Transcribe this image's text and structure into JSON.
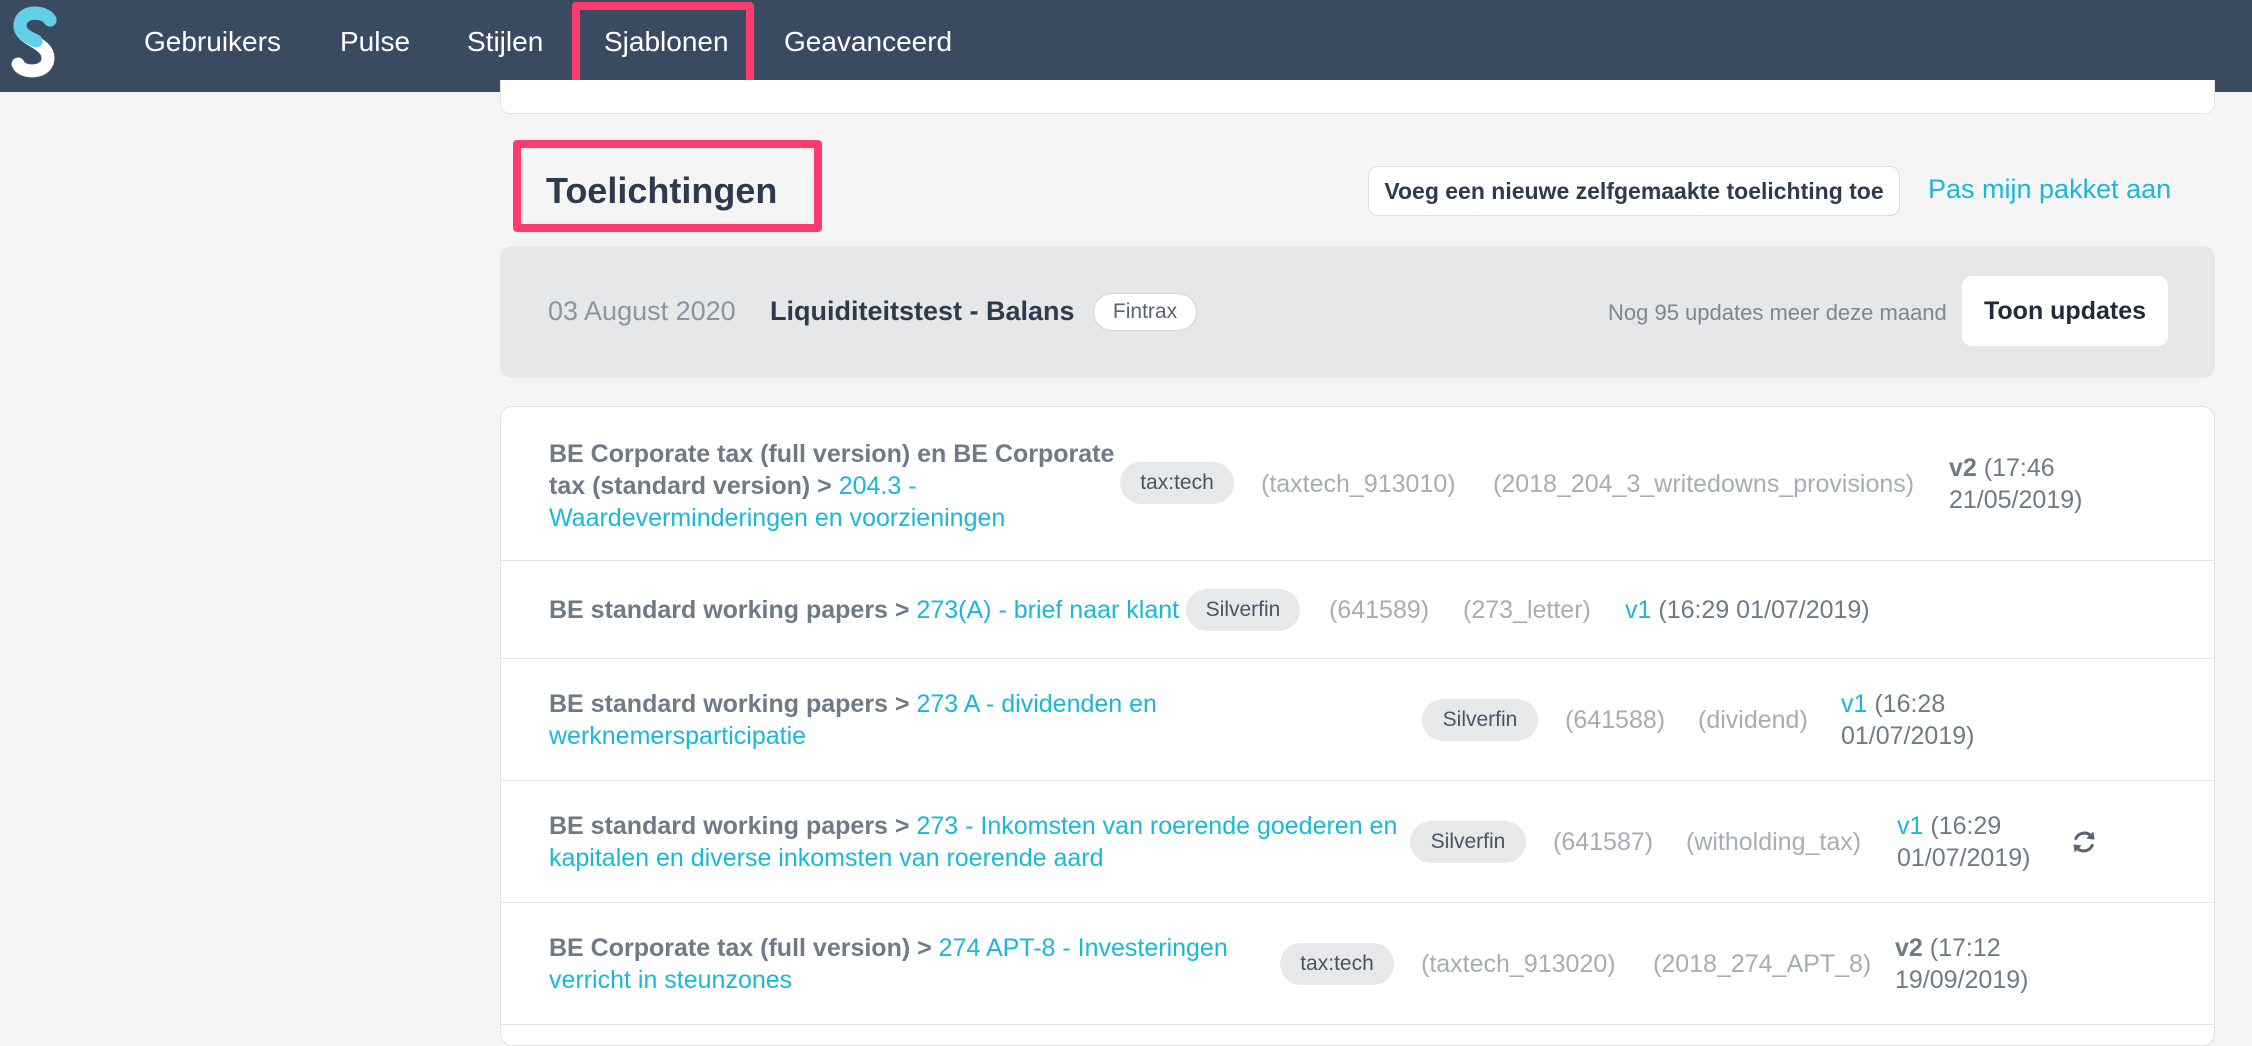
{
  "nav": {
    "logo_letter": "S",
    "items": [
      "Gebruikers",
      "Pulse",
      "Stijlen",
      "Sjablonen",
      "Geavanceerd"
    ],
    "active": "Sjablonen"
  },
  "section": {
    "title": "Toelichtingen",
    "add_button": "Voeg een nieuwe zelfgemaakte toelichting toe",
    "package_link": "Pas mijn pakket aan"
  },
  "updates": {
    "date": "03 August 2020",
    "title": "Liquiditeitstest - Balans",
    "tag": "Fintrax",
    "count_text": "Nog 95 updates meer deze maand",
    "button": "Toon updates"
  },
  "rows": [
    {
      "path_line1": "BE Corporate tax (full version) en BE Corporate",
      "path_line2": "tax (standard version) > ",
      "link_line2": "204.3 -",
      "link_line3": "Waardeverminderingen en voorzieningen",
      "tag": "tax:tech",
      "id": "(taxtech_913010)",
      "handle": "(2018_204_3_writedowns_provisions)",
      "version": "v2",
      "time_line1": " (17:46",
      "time_line2": "21/05/2019)"
    },
    {
      "path": "BE standard working papers > ",
      "link": "273(A) - brief naar klant",
      "tag": "Silverfin",
      "id": "(641589)",
      "handle": "(273_letter)",
      "version": "v1",
      "time": " (16:29 01/07/2019)"
    },
    {
      "path": "BE standard working papers > ",
      "link_line1": "273 A - dividenden en",
      "link_line2": "werknemersparticipatie",
      "tag": "Silverfin",
      "id": "(641588)",
      "handle": "(dividend)",
      "version": "v1",
      "time_line1": " (16:28",
      "time_line2": "01/07/2019)"
    },
    {
      "path": "BE standard working papers > ",
      "link_line1": "273 - Inkomsten van roerende goederen en",
      "link_line2": "kapitalen en diverse inkomsten van roerende aard",
      "tag": "Silverfin",
      "id": "(641587)",
      "handle": "(witholding_tax)",
      "version": "v1",
      "time_line1": " (16:29",
      "time_line2": "01/07/2019)",
      "icon": "refresh-icon"
    },
    {
      "path": "BE Corporate tax (full version) > ",
      "link_line1": "274 APT-8 - Investeringen",
      "link_line2": "verricht in steunzones",
      "tag": "tax:tech",
      "id": "(taxtech_913020)",
      "handle": "(2018_274_APT_8)",
      "version": "v2",
      "time_line1": " (17:12",
      "time_line2": "19/09/2019)"
    }
  ],
  "colors": {
    "navbar": "#3a4a60",
    "accent": "#19b8d8",
    "highlight": "#ff3a6e"
  }
}
